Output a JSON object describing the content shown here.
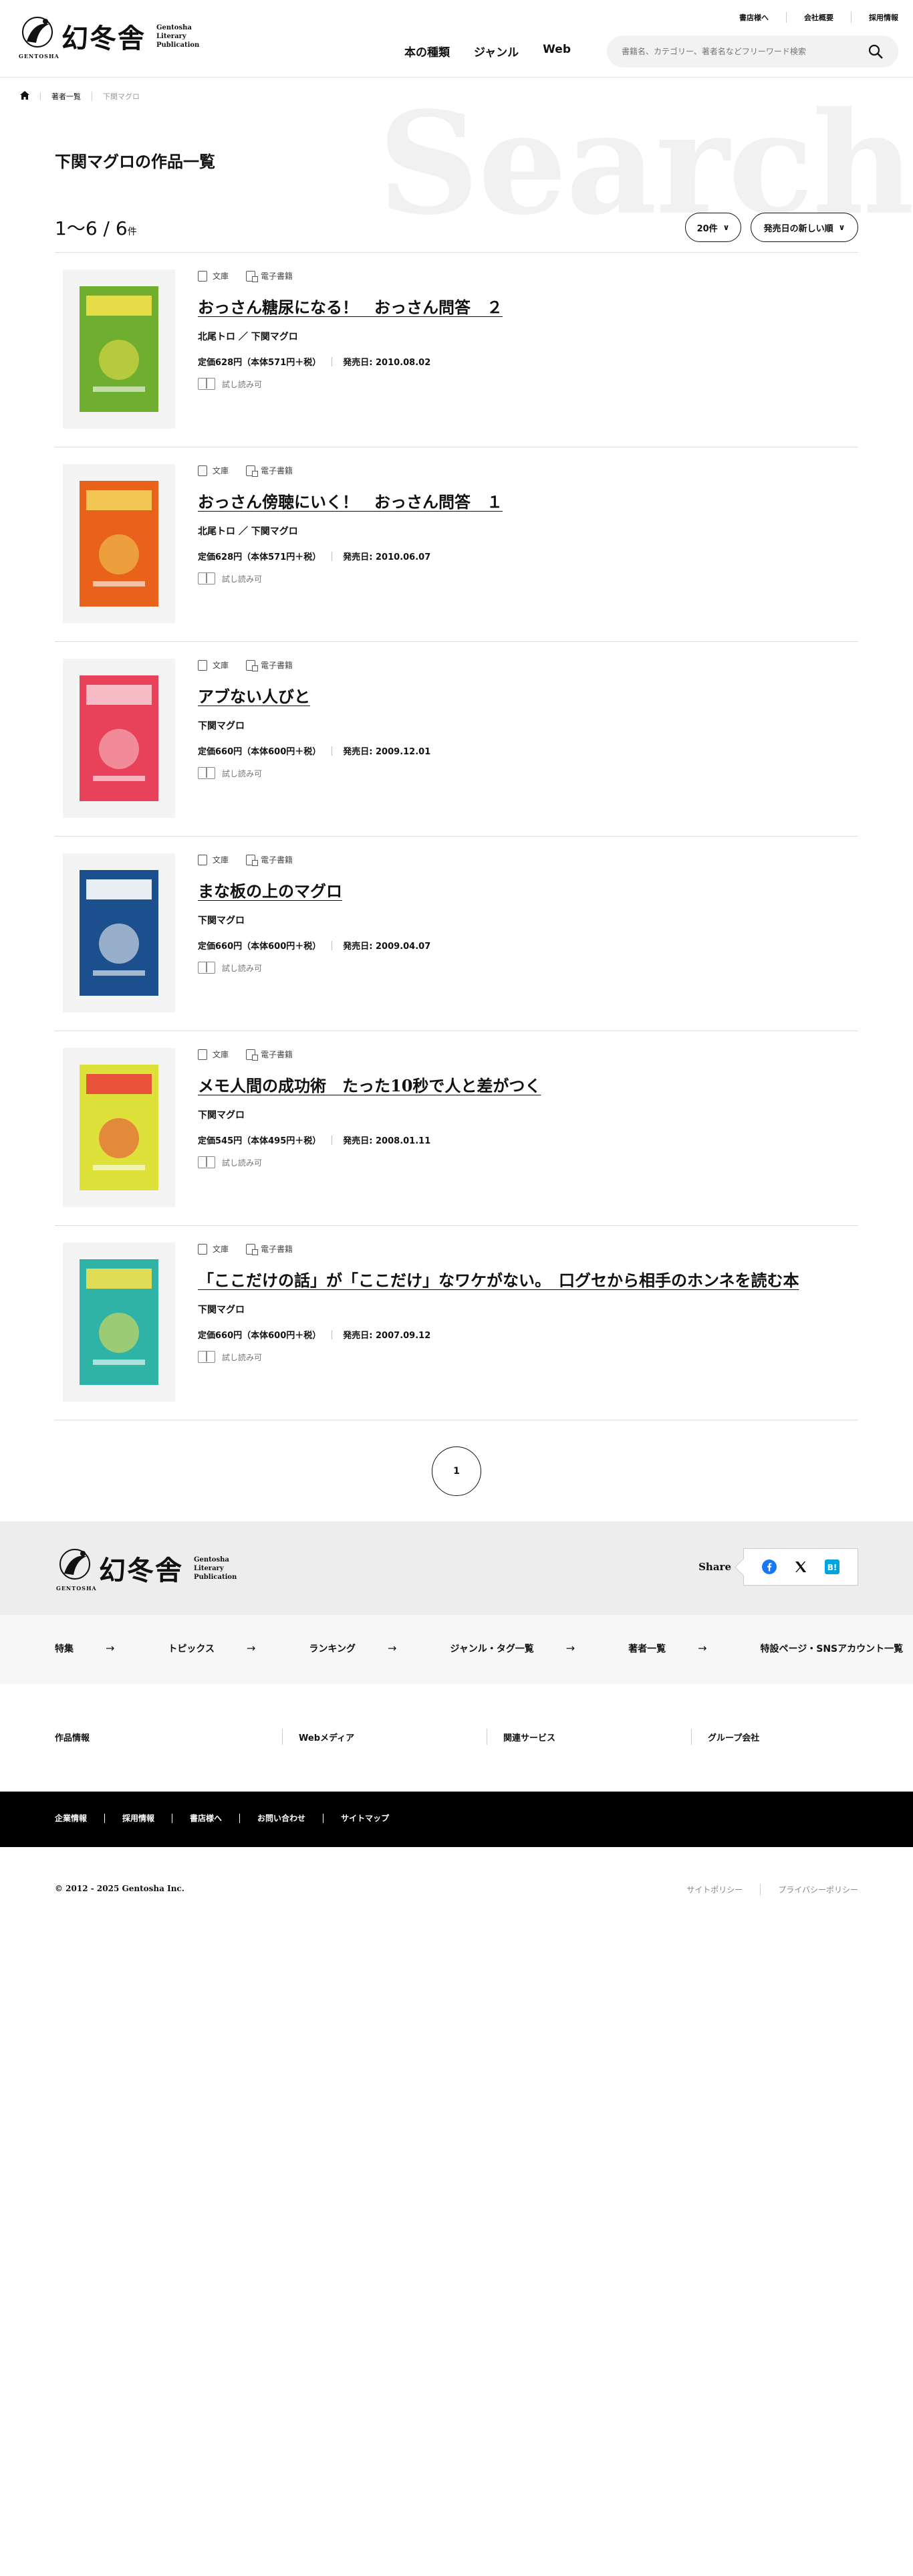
{
  "header": {
    "logo_kanji": "幻冬舎",
    "logo_sub": [
      "Gentosha",
      "Literary",
      "Publication"
    ],
    "logo_latin": "GENTOSHA",
    "top_links": [
      "書店様へ",
      "会社概要",
      "採用情報"
    ],
    "nav": [
      "本の種類",
      "ジャンル",
      "Web"
    ],
    "search_placeholder": "書籍名、カテゴリー、著者名などフリーワード検索"
  },
  "breadcrumb": [
    "著者一覧",
    "下関マグロ"
  ],
  "bg_text": "Search",
  "page_title": "下関マグロの作品一覧",
  "count": {
    "text": "1～6 / 6",
    "unit": "件"
  },
  "controls": {
    "per_page": "20件",
    "sort": "発売日の新しい順"
  },
  "tag_labels": {
    "bunko": "文庫",
    "ebook": "電子書籍",
    "trial": "試し読み可"
  },
  "books": [
    {
      "title": "おっさん糖尿になる！　おっさん問答　２",
      "authors": "北尾トロ ／ 下関マグロ",
      "price": "定価628円（本体571円＋税）",
      "date": "発売日: 2010.08.02",
      "cover": {
        "bg": "#6fae2e",
        "accent": "#f2e14b"
      }
    },
    {
      "title": "おっさん傍聴にいく！　おっさん問答　１",
      "authors": "北尾トロ ／ 下関マグロ",
      "price": "定価628円（本体571円＋税）",
      "date": "発売日: 2010.06.07",
      "cover": {
        "bg": "#e8621c",
        "accent": "#f3d15a"
      }
    },
    {
      "title": "アブない人びと",
      "authors": "下関マグロ",
      "price": "定価660円（本体600円＋税）",
      "date": "発売日: 2009.12.01",
      "cover": {
        "bg": "#e8425a",
        "accent": "#f7c9d0"
      }
    },
    {
      "title": "まな板の上のマグロ",
      "authors": "下関マグロ",
      "price": "定価660円（本体600円＋税）",
      "date": "発売日: 2009.04.07",
      "cover": {
        "bg": "#1c4f8d",
        "accent": "#ffffff"
      }
    },
    {
      "title": "メモ人間の成功術　たった10秒で人と差がつく",
      "authors": "下関マグロ",
      "price": "定価545円（本体495円＋税）",
      "date": "発売日: 2008.01.11",
      "cover": {
        "bg": "#dde13a",
        "accent": "#e8423a"
      }
    },
    {
      "title": "「ここだけの話」が「ここだけ」なワケがない。　口グセから相手のホンネを読む本",
      "authors": "下関マグロ",
      "price": "定価660円（本体600円＋税）",
      "date": "発売日: 2007.09.12",
      "cover": {
        "bg": "#2fb3a6",
        "accent": "#f4e04d"
      }
    }
  ],
  "pager": {
    "current": "1"
  },
  "footer": {
    "share_label": "Share",
    "social": [
      "facebook-icon",
      "x-icon",
      "hatena-icon"
    ],
    "nav": [
      "特集",
      "トピックス",
      "ランキング",
      "ジャンル・タグ一覧",
      "著者一覧",
      "特設ページ・SNSアカウント一覧"
    ],
    "cols": [
      "作品情報",
      "Webメディア",
      "関連サービス",
      "グループ会社"
    ],
    "black_links": [
      "企業情報",
      "採用情報",
      "書店様へ",
      "お問い合わせ",
      "サイトマップ"
    ],
    "copyright": "© 2012 - 2025 Gentosha Inc.",
    "policy": [
      "サイトポリシー",
      "プライバシーポリシー"
    ]
  },
  "colors": {
    "facebook": "#1877f2",
    "hatena": "#00a4de"
  }
}
